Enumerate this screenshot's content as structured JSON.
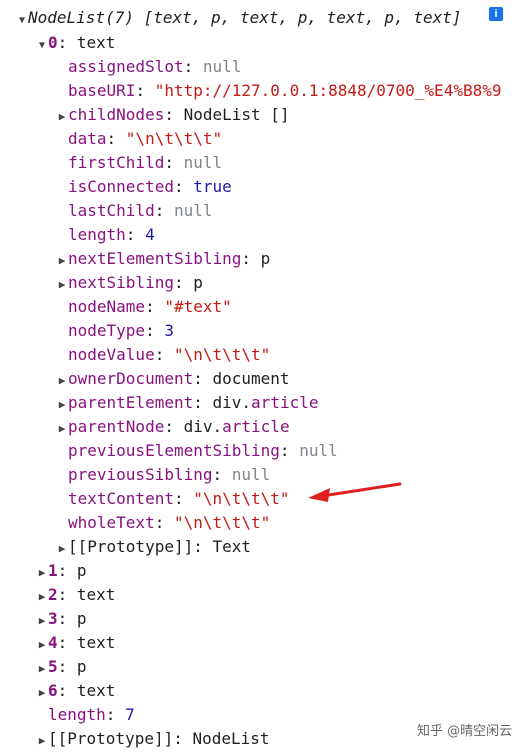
{
  "header": {
    "title": "NodeList(7)",
    "summary": "[text, p, text, p, text, p, text]",
    "info_icon": "i"
  },
  "item0": {
    "index": "0",
    "type": "text",
    "props": [
      {
        "key": "assignedSlot",
        "value": "null",
        "kind": "null",
        "expandable": false
      },
      {
        "key": "baseURI",
        "value": "\"http://127.0.0.1:8848/0700_%E4%B8%9",
        "kind": "str",
        "expandable": false
      },
      {
        "key": "childNodes",
        "value": "NodeList []",
        "kind": "obj",
        "expandable": true
      },
      {
        "key": "data",
        "value": "\"\\n\\t\\t\\t\"",
        "kind": "str",
        "expandable": false
      },
      {
        "key": "firstChild",
        "value": "null",
        "kind": "null",
        "expandable": false
      },
      {
        "key": "isConnected",
        "value": "true",
        "kind": "bool",
        "expandable": false
      },
      {
        "key": "lastChild",
        "value": "null",
        "kind": "null",
        "expandable": false
      },
      {
        "key": "length",
        "value": "4",
        "kind": "num",
        "expandable": false
      },
      {
        "key": "nextElementSibling",
        "value": "p",
        "kind": "obj",
        "expandable": true
      },
      {
        "key": "nextSibling",
        "value": "p",
        "kind": "obj",
        "expandable": true
      },
      {
        "key": "nodeName",
        "value": "\"#text\"",
        "kind": "str",
        "expandable": false
      },
      {
        "key": "nodeType",
        "value": "3",
        "kind": "num",
        "expandable": false
      },
      {
        "key": "nodeValue",
        "value": "\"\\n\\t\\t\\t\"",
        "kind": "str",
        "expandable": false
      },
      {
        "key": "ownerDocument",
        "value": "document",
        "kind": "obj",
        "expandable": true
      },
      {
        "key": "parentElement",
        "value": "div.article",
        "kind": "elem",
        "expandable": true
      },
      {
        "key": "parentNode",
        "value": "div.article",
        "kind": "elem",
        "expandable": true
      },
      {
        "key": "previousElementSibling",
        "value": "null",
        "kind": "null",
        "expandable": false
      },
      {
        "key": "previousSibling",
        "value": "null",
        "kind": "null",
        "expandable": false
      },
      {
        "key": "textContent",
        "value": "\"\\n\\t\\t\\t\"",
        "kind": "str",
        "expandable": false
      },
      {
        "key": "wholeText",
        "value": "\"\\n\\t\\t\\t\"",
        "kind": "str",
        "expandable": false
      },
      {
        "key": "[[Prototype]]",
        "value": "Text",
        "kind": "obj",
        "expandable": true,
        "proto": true
      }
    ]
  },
  "items": [
    {
      "index": "1",
      "type": "p"
    },
    {
      "index": "2",
      "type": "text"
    },
    {
      "index": "3",
      "type": "p"
    },
    {
      "index": "4",
      "type": "text"
    },
    {
      "index": "5",
      "type": "p"
    },
    {
      "index": "6",
      "type": "text"
    }
  ],
  "length_row": {
    "key": "length",
    "value": "7"
  },
  "proto_row": {
    "key": "[[Prototype]]",
    "value": "NodeList"
  },
  "annotation": {
    "color": "#e02020"
  },
  "watermark": "知乎 @晴空闲云"
}
